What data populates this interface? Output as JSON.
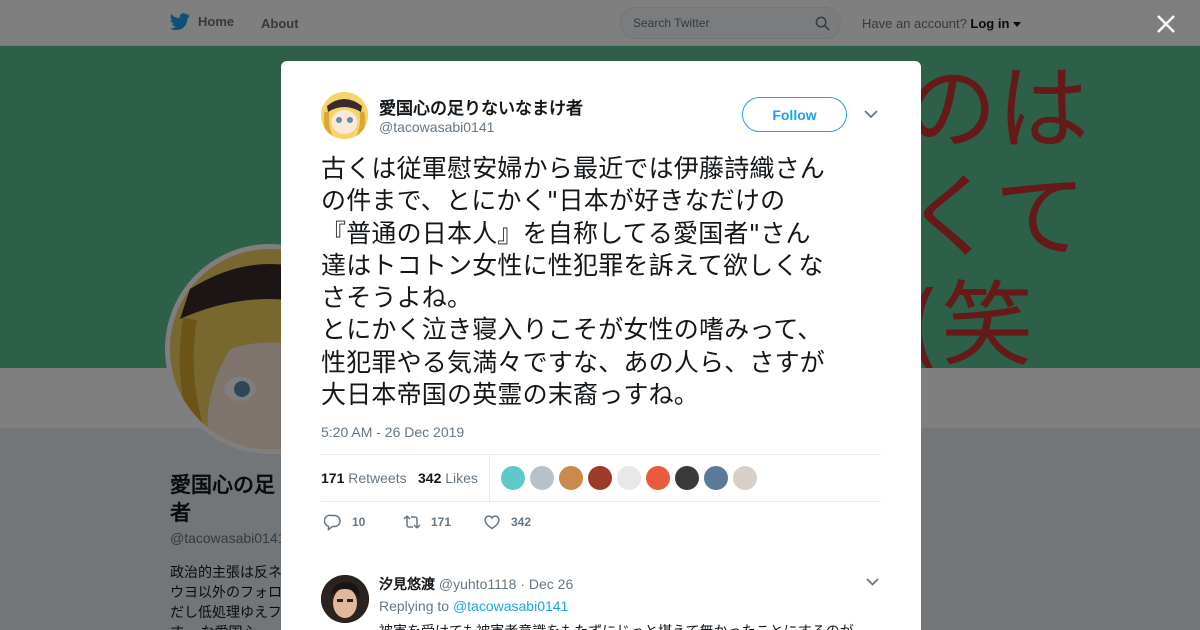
{
  "header": {
    "home_label": "Home",
    "about_label": "About",
    "search_placeholder": "Search Twitter",
    "account_prompt": "Have an account?",
    "login_label": "Log in"
  },
  "banner": {
    "line1": "のは",
    "line2": "くて",
    "line3": "(笑"
  },
  "profile": {
    "name_partial": "愛国心の足",
    "name_partial2": "者",
    "handle_partial": "@tacowasabi0141",
    "bio_partial": "政治的主張は反ネ ウヨ以外のフォロ だし低処理ゆえフ す。 な愛国心"
  },
  "tweet": {
    "author_name": "愛国心の足りないなまけ者",
    "author_handle": "@tacowasabi0141",
    "follow_label": "Follow",
    "text": "古くは従軍慰安婦から最近では伊藤詩織さん\nの件まで、とにかく\"日本が好きなだけの\n『普通の日本人』を自称してる愛国者\"さん\n達はトコトン女性に性犯罪を訴えて欲しくな\nさそうよね。\nとにかく泣き寝入りこそが女性の嗜みって、\n性犯罪やる気満々ですな、あの人ら、さすが\n大日本帝国の英霊の末裔っすね。",
    "timestamp": "5:20 AM - 26 Dec 2019",
    "retweets_count": "171",
    "retweets_label": "Retweets",
    "likes_count": "342",
    "likes_label": "Likes",
    "reply_count": "10",
    "retweet_action_count": "171",
    "like_action_count": "342"
  },
  "likers": {
    "colors": [
      "#5fc9c9",
      "#b8c1c9",
      "#c98a4a",
      "#9b3b2a",
      "#e8e8e8",
      "#e85a3c",
      "#3a3a3a",
      "#5a7a9a",
      "#d8d0c8"
    ]
  },
  "reply": {
    "name": "汐見悠渡",
    "handle": "@yuhto1118",
    "date": "Dec 26",
    "replying_prefix": "Replying to",
    "replying_to": "@tacowasabi0141",
    "text": "被害を受けても被害者意識をもたずにじっと堪えて無かったことにするのが"
  },
  "colors": {
    "accent": "#1da1f2",
    "banner": "#5ac190"
  }
}
